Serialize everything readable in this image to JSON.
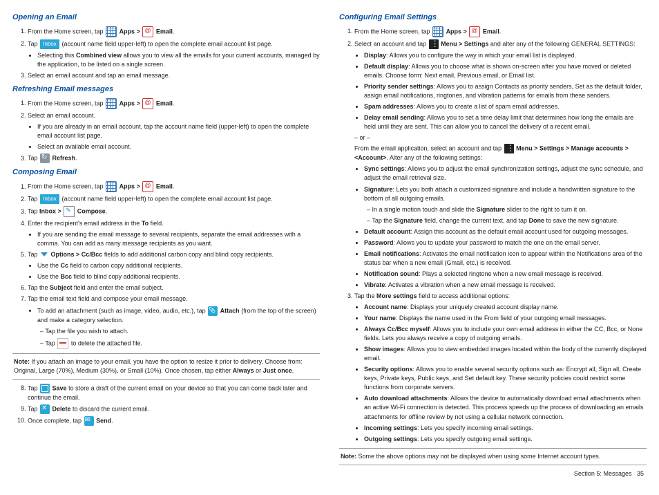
{
  "left": {
    "h_open": "Opening an Email",
    "open1a": "From the Home screen, tap ",
    "apps_gt": "Apps > ",
    "email": "Email",
    "open2a": "Tap ",
    "inbox_badge": "Inbox",
    "open2b": " (account name field upper-left) to open the complete email account list page.",
    "open2_bul": "Selecting this ",
    "open2_bold": "Combined view",
    "open2_bul2": " allows you to view all the emails for your current accounts, managed by the application, to be listed on a single screen.",
    "open3": "Select an email account and tap an email message.",
    "h_refresh": "Refreshing Email messages",
    "ref1": "From the Home screen, tap ",
    "ref2": "Select an email account.",
    "ref2a": "If you are already in an email account, tap the account name field (upper-left) to open the complete email account list page.",
    "ref2b": "Select an available email account.",
    "ref3a": "Tap ",
    "ref3b": "Refresh",
    "h_compose": "Composing Email",
    "c1": "From the Home screen, tap ",
    "c2a": "Tap ",
    "c2b": " (account name field upper-left) to open the complete email account list page.",
    "c3a": "Tap ",
    "c3b": "Inbox > ",
    "c3c": "Compose",
    "c4a": "Enter the recipient's email address in the ",
    "c4b": "To",
    "c4c": " field.",
    "c4bul": "If you are sending the email message to several recipients, separate the email addresses with a comma. You can add as many message recipients as you want.",
    "c5a": "Tap ",
    "c5b": "Options > Cc/Bcc",
    "c5c": " fields to add additional carbon copy and blind copy recipients.",
    "c5bul1a": "Use the ",
    "c5bul1b": "Cc",
    "c5bul1c": " field to carbon copy additional recipients.",
    "c5bul2a": "Use the ",
    "c5bul2b": "Bcc",
    "c5bul2c": " field to blind copy additional recipients.",
    "c6a": "Tap the ",
    "c6b": "Subject",
    "c6c": " field and enter the email subject.",
    "c7": "Tap the email text field and compose your email message.",
    "c7bul_a": "To add an attachment (such as image, video, audio, etc.), tap ",
    "c7bul_b": "Attach",
    "c7bul_c": " (from the top of the screen) and make a category selection.",
    "c7d1": "Tap the file you wish to attach.",
    "c7d2a": "Tap ",
    "c7d2b": " to delete the attached file.",
    "note1a": "Note:",
    "note1b": " If you attach an image to your email, you have the option to resize it prior to delivery. Choose from: Original, Large (70%), Medium (30%), or Small (10%). Once chosen, tap either ",
    "note1c": "Always",
    "note1d": " or ",
    "note1e": "Just once",
    "c8a": "Tap ",
    "c8b": "Save",
    "c8c": " to store a draft of the current email on your device so that you can come back later and continue the email.",
    "c9a": "Tap ",
    "c9b": "Delete",
    "c9c": " to discard the current email.",
    "c10a": "Once complete, tap ",
    "c10b": "Send"
  },
  "right": {
    "h_conf": "Configuring Email Settings",
    "s1": "From the Home screen, tap ",
    "s2a": "Select an account and tap ",
    "s2b": "Menu > Settings",
    "s2c": " and alter any of the following GENERAL SETTINGS:",
    "b_display": "Display",
    "b_display_t": ": Allows you to configure the way in which your email list is displayed.",
    "b_defdisp": "Default display",
    "b_defdisp_t": ": Allows you to choose what is shown on-screen after you have moved or deleted emails. Choose form: Next email, Previous email, or Email list.",
    "b_prio": "Priority sender settings",
    "b_prio_t": ": Allows you to assign Contacts as priority senders, Set as the default folder, assign email notifications, ringtones, and vibration patterns for emails from these senders.",
    "b_spam": "Spam addresses",
    "b_spam_t": ": Allows you to create a list of spam email addresses.",
    "b_delay": "Delay email sending",
    "b_delay_t": ": Allows you to set a time delay limit that determines how long the emails are held until they are sent. This can allow you to cancel the delivery of a recent email.",
    "or": "– or –",
    "from_app": "From the email application, select an account and tap ",
    "menu_path": "Menu > Settings > Manage accounts > <Account>",
    "alter": ". Alter any of the following settings:",
    "sync": "Sync settings",
    "sync_t": ": Allows you to adjust the email synchronization settings, adjust the sync schedule, and adjust the email retrieval size.",
    "sig": "Signature",
    "sig_t": ": Lets you both attach a customized signature and include a handwritten signature to the bottom of all outgoing emails.",
    "sig_d1a": "In a single motion touch and slide the ",
    "sig_d1b": "Signature",
    "sig_d1c": " slider to the right to turn it on.",
    "sig_d2a": "Tap the ",
    "sig_d2b": "Signature",
    "sig_d2c": " field, change the current text, and tap ",
    "sig_d2d": "Done",
    "sig_d2e": " to save the new signature.",
    "defacc": "Default account",
    "defacc_t": ": Assign this account as the default email account used for outgoing messages.",
    "pwd": "Password",
    "pwd_t": ": Allows you to update your password to match the one on the email server.",
    "enotif": "Email notifications",
    "enotif_t": ": Activates the email notification icon to appear within the Notifications area of the status bar when a new email (Gmail, etc.) is received.",
    "nsound": "Notification sound",
    "nsound_t": ": Plays a selected ringtone when a new email message is received.",
    "vib": "Vibrate",
    "vib_t": ": Activates a vibration when a new email message is received.",
    "s3a": "Tap the ",
    "s3b": "More settings",
    "s3c": " field to access additional options:",
    "acctname": "Account name",
    "acctname_t": ": Displays your uniquely created account display name.",
    "yname": "Your name",
    "yname_t": ": Displays the name used in the From field of your outgoing email messages.",
    "always": "Always Cc/Bcc myself",
    "always_t": ": Allows you to include your own email address in either the CC, Bcc, or None fields. Lets you always receive a copy of outgoing emails.",
    "showimg": "Show images",
    "showimg_t": ": Allows you to view embedded images located within the body of the currently displayed email.",
    "secopt": "Security options",
    "secopt_t": ": Allows you to enable several security options such as: Encrypt all, Sign all, Create keys, Private keys, Public keys, and Set default key. These security policies could restrict some functions from corporate servers.",
    "autodl": "Auto download attachments",
    "autodl_t": ": Allows the device to automatically download email attachments when an active Wi-Fi connection is detected. This process speeds up the process of downloading an emails attachments for offline review by not using a cellular network connection.",
    "incoming": "Incoming settings",
    "incoming_t": ": Lets you specify incoming email settings.",
    "outgoing": "Outgoing settings",
    "outgoing_t": ": Lets you specify outgoing email settings.",
    "note2a": "Note:",
    "note2b": " Some the above options may not be displayed when using some Internet account types."
  },
  "footer": {
    "section": "Section 5:  Messages",
    "page": "35"
  }
}
